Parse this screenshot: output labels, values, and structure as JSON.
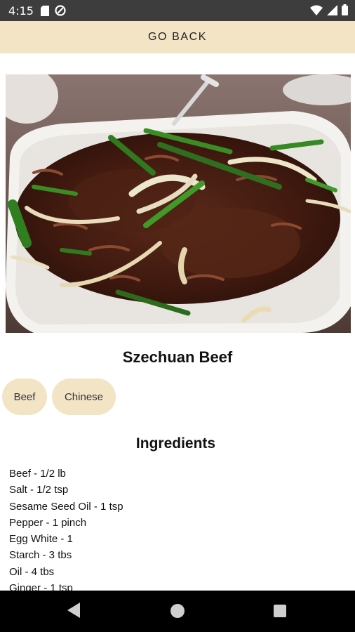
{
  "status_bar": {
    "time": "4:15",
    "left_icons": [
      "sd-card-icon",
      "no-disturb-icon"
    ],
    "right_icons": [
      "wifi-icon",
      "signal-icon",
      "battery-icon"
    ]
  },
  "header": {
    "go_back_label": "GO BACK"
  },
  "recipe": {
    "image_alt": "plate of stir-fried beef with onions and scallions",
    "title": "Szechuan Beef",
    "tags": [
      "Beef",
      "Chinese"
    ]
  },
  "ingredients": {
    "heading": "Ingredients",
    "items": [
      "Beef - 1/2 lb",
      "Salt - 1/2 tsp",
      "Sesame Seed Oil - 1 tsp",
      "Pepper - 1 pinch",
      "Egg White - 1",
      "Starch - 3 tbs",
      "Oil - 4 tbs",
      "Ginger - 1 tsp"
    ]
  },
  "nav_bar": {
    "icons": [
      "back-triangle-icon",
      "home-circle-icon",
      "recents-square-icon"
    ]
  },
  "colors": {
    "accent": "#f3e4c6",
    "status_bar": "#3d3d3d",
    "nav_bar": "#000000"
  }
}
